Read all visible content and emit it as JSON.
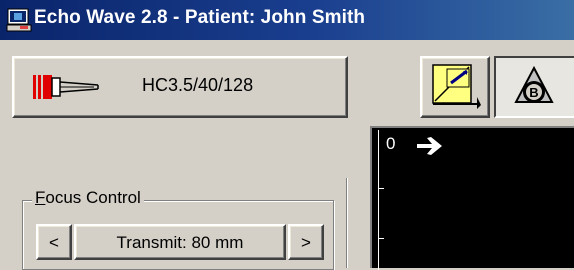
{
  "window": {
    "title": "Echo Wave 2.8 - Patient: John Smith"
  },
  "transducer": {
    "label": "HC3.5/40/128",
    "icon": "transducer-probe-icon",
    "icon_color": "#e00000"
  },
  "toolbar": {
    "tool1_icon": "measure-tool-icon",
    "tool2_icon": "b-mode-icon"
  },
  "image_view": {
    "depth_start": "0",
    "arrow_icon": "right-arrow-icon"
  },
  "focus_control": {
    "title_prefix": "",
    "title_accel": "F",
    "title_rest": "ocus Control",
    "left_label": "<",
    "value_label": "Transmit: 80 mm",
    "right_label": ">"
  },
  "colors": {
    "titlebar": "#0a246a",
    "face": "#d4d0c8"
  }
}
